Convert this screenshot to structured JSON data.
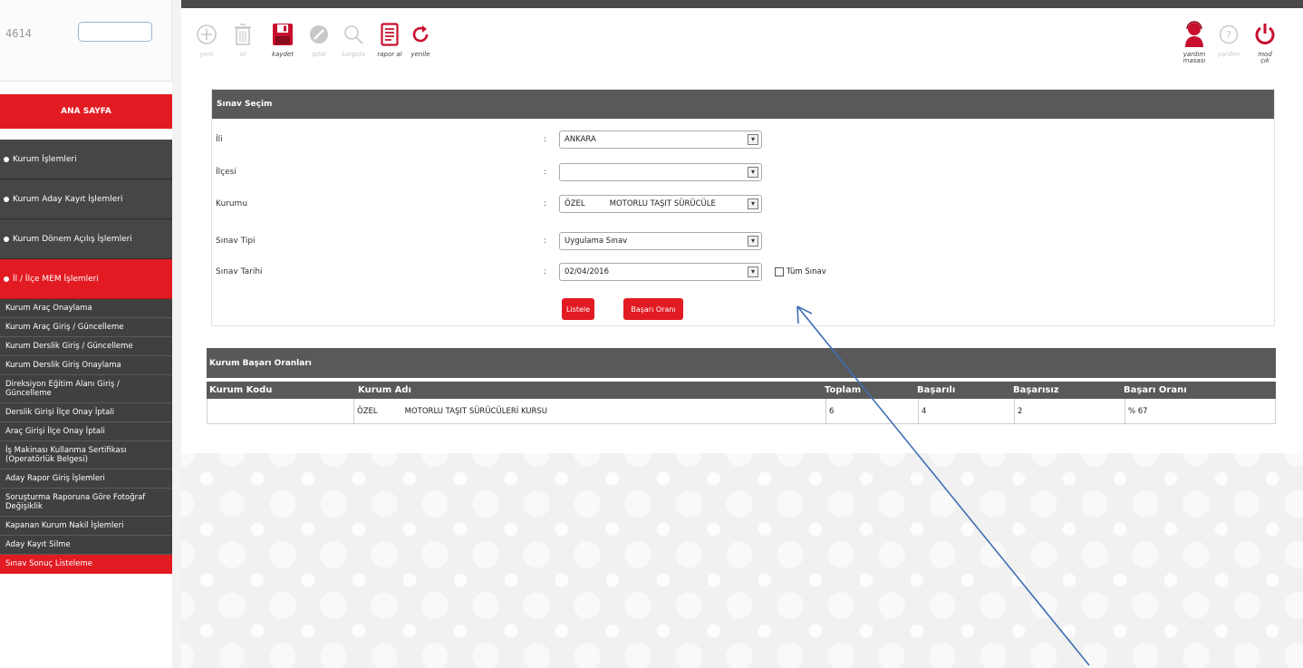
{
  "user": {
    "code": "4614"
  },
  "sidebar": {
    "home": "ANA SAYFA",
    "groups": [
      {
        "label": "Kurum İşlemleri"
      },
      {
        "label": "Kurum Aday Kayıt İşlemleri"
      },
      {
        "label": "Kurum Dönem Açılış İşlemleri"
      },
      {
        "label": "İl / İlçe MEM İşlemleri"
      }
    ],
    "items": [
      {
        "label": "Kurum Araç Onaylama"
      },
      {
        "label": "Kurum Araç Giriş / Güncelleme"
      },
      {
        "label": "Kurum Derslik Giriş / Güncelleme"
      },
      {
        "label": "Kurum Derslik Giriş Onaylama"
      },
      {
        "label": "Direksiyon Eğitim Alanı Giriş / Güncelleme"
      },
      {
        "label": "Derslik Girişi İlçe Onay İptali"
      },
      {
        "label": "Araç Girişi İlçe Onay İptali"
      },
      {
        "label": "İş Makinası Kullanma Sertifikası (Operatörlük Belgesi)"
      },
      {
        "label": "Aday Rapor Giriş İşlemleri"
      },
      {
        "label": "Soruşturma Raporuna Göre Fotoğraf Değişiklik"
      },
      {
        "label": "Kapanan Kurum Nakil İşlemleri"
      },
      {
        "label": "Aday Kayıt Silme"
      },
      {
        "label": "Sınav Sonuç Listeleme"
      }
    ]
  },
  "toolbar": {
    "yeni": "yeni",
    "sil": "sil",
    "kaydet": "kaydet",
    "iptal": "iptal",
    "sorgula": "sorgula",
    "rapor_al": "rapor al",
    "yenile": "yenile",
    "yardim_line1": "yardım",
    "yardim_line2": "masası",
    "yardim": "yardım",
    "cikis_line1": "mod",
    "cikis_line2": "çık"
  },
  "form": {
    "title": "Sınav Seçim",
    "fields": [
      {
        "label": "İli",
        "value": "ANKARA"
      },
      {
        "label": "İlçesi",
        "value": ""
      },
      {
        "label": "Kurumu",
        "value": "ÖZEL          MOTORLU TAŞIT SÜRÜCÜLE"
      },
      {
        "label": "Sınav Tipi",
        "value": "Uygulama Sınav"
      },
      {
        "label": "Sınav Tarihi",
        "value": "02/04/2016"
      }
    ],
    "colon": ":",
    "arrow_glyph": "▾",
    "all_exams_label": "Tüm Sınav",
    "list_button": "Listele",
    "success_button": "Başarı Oranı"
  },
  "results": {
    "title": "Kurum Başarı Oranları",
    "columns": [
      "Kurum Kodu",
      "Kurum Adı",
      "Toplam",
      "Başarılı",
      "Başarısız",
      "Başarı Oranı"
    ],
    "rows": [
      {
        "code": "",
        "name_prefix": "ÖZEL",
        "name": "MOTORLU TAŞIT SÜRÜCÜLERİ KURSU",
        "total": "6",
        "passed": "4",
        "failed": "2",
        "rate": "% 67"
      }
    ]
  },
  "colors": {
    "accent_red": "#e21b23",
    "header_gray": "#595959",
    "sidebar_dark": "#404040",
    "annotation_blue": "#3f6fb5"
  }
}
